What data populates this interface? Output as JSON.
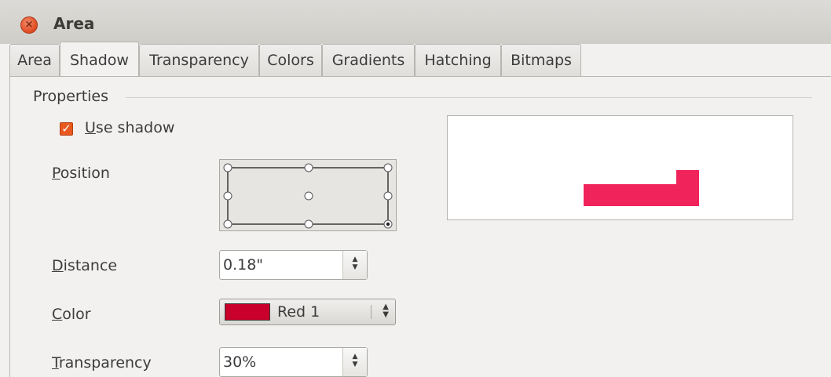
{
  "window": {
    "title": "Area"
  },
  "tabs": [
    {
      "label": "Area",
      "active": false
    },
    {
      "label": "Shadow",
      "active": true
    },
    {
      "label": "Transparency",
      "active": false
    },
    {
      "label": "Colors",
      "active": false
    },
    {
      "label": "Gradients",
      "active": false
    },
    {
      "label": "Hatching",
      "active": false
    },
    {
      "label": "Bitmaps",
      "active": false
    }
  ],
  "properties": {
    "section_label": "Properties",
    "use_shadow": {
      "label_first": "U",
      "label_rest": "se shadow",
      "checked": true
    },
    "position": {
      "label_first": "P",
      "label_rest": "osition",
      "selected": "bottom-right"
    },
    "distance": {
      "label_first": "D",
      "label_rest": "istance",
      "value": "0.18\""
    },
    "color": {
      "label_first": "C",
      "label_rest": "olor",
      "value": "Red 1",
      "swatch": "#c9002b"
    },
    "transparency": {
      "label_first": "T",
      "label_rest": "ransparency",
      "value": "30%"
    }
  },
  "preview": {
    "shape_color": "#f0245a"
  }
}
